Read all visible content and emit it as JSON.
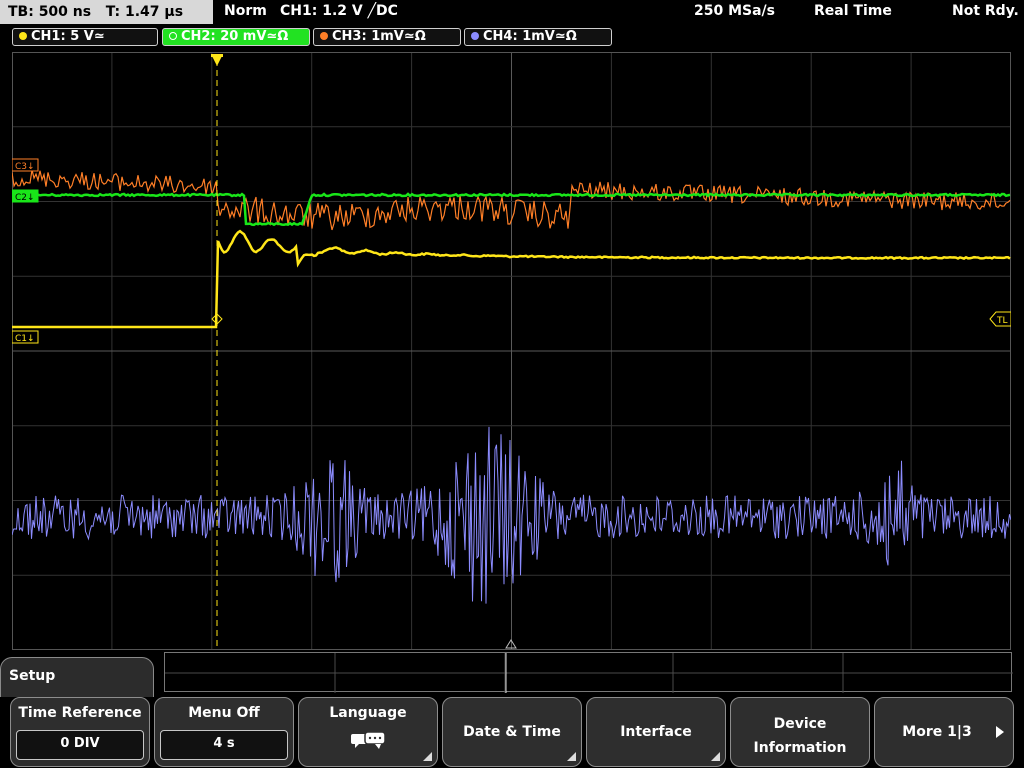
{
  "top": {
    "timebase": "TB: 500 ns",
    "trigger_time": "T: 1.47 µs",
    "mode": "Norm",
    "trigger_source": "CH1: 1.2 V ╱DC",
    "sample_rate": "250 MSa/s",
    "acq_mode": "Real Time",
    "status": "Not Rdy."
  },
  "channels": [
    {
      "label": "CH1: 5 V≃",
      "color": "#ffe619"
    },
    {
      "label": "CH2: 20 mV≃Ω",
      "color": "#19e619"
    },
    {
      "label": "CH3: 1mV≃Ω",
      "color": "#ff7f27"
    },
    {
      "label": "CH4: 1mV≃Ω",
      "color": "#8c8cff"
    }
  ],
  "markers": {
    "c3": "C3↓",
    "c2": "C2↓",
    "c1": "C1↓",
    "trigger_level": "TL"
  },
  "menu": {
    "title": "Setup",
    "softkeys": [
      {
        "label": "Time Reference",
        "value": "0 DIV"
      },
      {
        "label": "Menu Off",
        "value": "4 s"
      },
      {
        "label": "Language",
        "value": ""
      },
      {
        "label": "Date & Time",
        "value": ""
      },
      {
        "label": "Interface",
        "value": ""
      },
      {
        "label": "Device Information",
        "value": ""
      },
      {
        "label": "More 1|3",
        "value": ""
      }
    ]
  },
  "colors": {
    "ch1": "#ffe619",
    "ch2": "#19e619",
    "ch3": "#ff7f27",
    "ch4": "#8c8cff",
    "grid": "#3a3a3a",
    "softkey_bg": "#2e2e2e"
  },
  "icons": {
    "language": "speech-bubbles-icon",
    "more": "play-arrow-icon",
    "trigger": "trigger-marker-icon"
  }
}
